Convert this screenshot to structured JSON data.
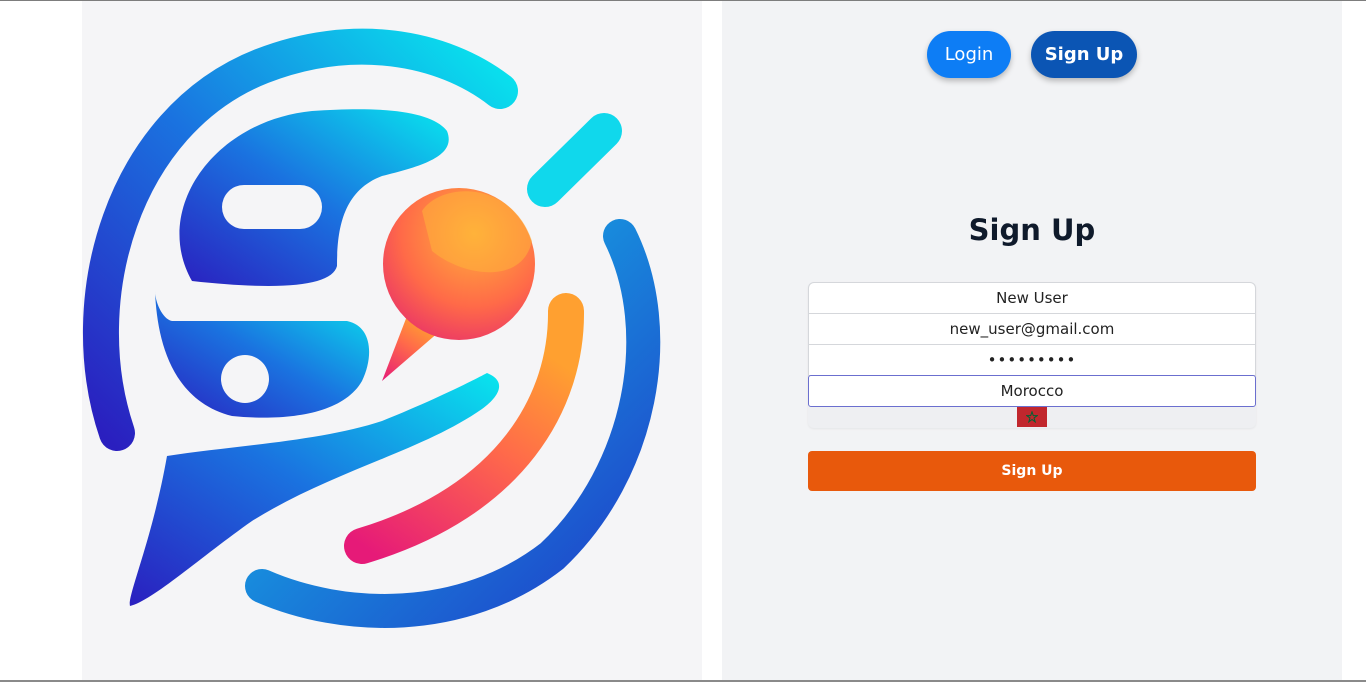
{
  "nav": {
    "login_label": "Login",
    "signup_label": "Sign Up"
  },
  "form": {
    "title": "Sign Up",
    "name_value": "New User",
    "email_value": "new_user@gmail.com",
    "password_value": "•••••••••",
    "country_value": "Morocco",
    "submit_label": "Sign Up"
  },
  "logo": {
    "icon": "chat-bubble-logo"
  },
  "colors": {
    "login_button": "#0d7df5",
    "signup_button": "#0b55b4",
    "submit_button": "#e8590c",
    "flag_red": "#c1272d",
    "flag_green": "#006233"
  }
}
